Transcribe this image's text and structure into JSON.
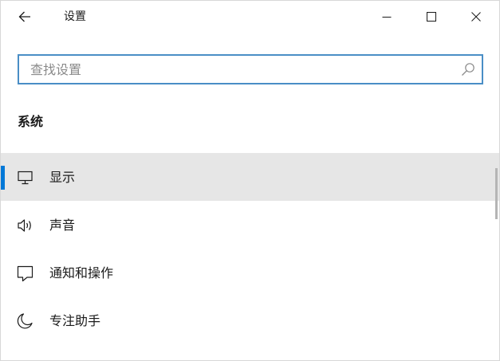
{
  "window": {
    "title": "设置"
  },
  "search": {
    "placeholder": "查找设置",
    "value": ""
  },
  "section": {
    "title": "系统"
  },
  "nav": {
    "items": [
      {
        "label": "显示",
        "icon": "monitor-icon",
        "selected": true
      },
      {
        "label": "声音",
        "icon": "speaker-icon",
        "selected": false
      },
      {
        "label": "通知和操作",
        "icon": "notification-icon",
        "selected": false
      },
      {
        "label": "专注助手",
        "icon": "moon-icon",
        "selected": false
      }
    ]
  },
  "colors": {
    "accent": "#0078d7",
    "selected_bg": "#e6e6e6",
    "search_border": "#4a8ec6"
  }
}
